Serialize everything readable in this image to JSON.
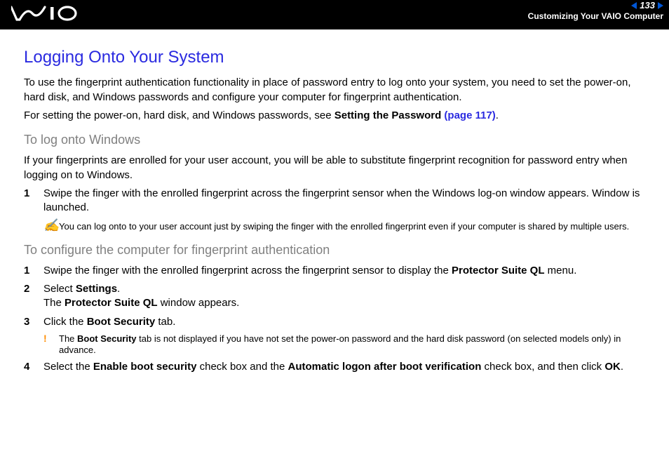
{
  "header": {
    "logo": "VAIO",
    "page_number": "133",
    "section": "Customizing Your VAIO Computer"
  },
  "title": "Logging Onto Your System",
  "intro1": "To use the fingerprint authentication functionality in place of password entry to log onto your system, you need to set the power-on, hard disk, and Windows passwords and configure your computer for fingerprint authentication.",
  "intro2_pre": "For setting the power-on, hard disk, and Windows passwords, see ",
  "intro2_bold": "Setting the Password",
  "intro2_link": " (page 117)",
  "intro2_post": ".",
  "sectionA": {
    "heading": "To log onto Windows",
    "para": "If your fingerprints are enrolled for your user account, you will be able to substitute fingerprint recognition for password entry when logging on to Windows.",
    "step1_num": "1",
    "step1_text": "Swipe the finger with the enrolled fingerprint across the fingerprint sensor when the Windows log-on window appears. Window is launched.",
    "note_icon": "✍",
    "note_text": "You can log onto to your user account just by swiping the finger with the enrolled fingerprint even if your computer is shared by multiple users."
  },
  "sectionB": {
    "heading": "To configure the computer for fingerprint authentication",
    "step1_num": "1",
    "step1_pre": "Swipe the finger with the enrolled fingerprint across the fingerprint sensor to display the ",
    "step1_bold": "Protector Suite QL",
    "step1_post": " menu.",
    "step2_num": "2",
    "step2_pre": "Select ",
    "step2_bold1": "Settings",
    "step2_mid": ".\nThe ",
    "step2_bold2": "Protector Suite QL",
    "step2_post": " window appears.",
    "step3_num": "3",
    "step3_pre": " Click the ",
    "step3_bold": "Boot Security",
    "step3_post": " tab.",
    "warn_icon": "!",
    "warn_pre": "The ",
    "warn_bold": "Boot Security",
    "warn_post": " tab is not displayed if you have not set the power-on password and the hard disk password (on selected models only) in advance.",
    "step4_num": "4",
    "step4_pre": "Select the ",
    "step4_bold1": "Enable boot security",
    "step4_mid1": " check box and the ",
    "step4_bold2": "Automatic logon after boot verification",
    "step4_mid2": " check box, and then click ",
    "step4_bold3": "OK",
    "step4_post": "."
  }
}
